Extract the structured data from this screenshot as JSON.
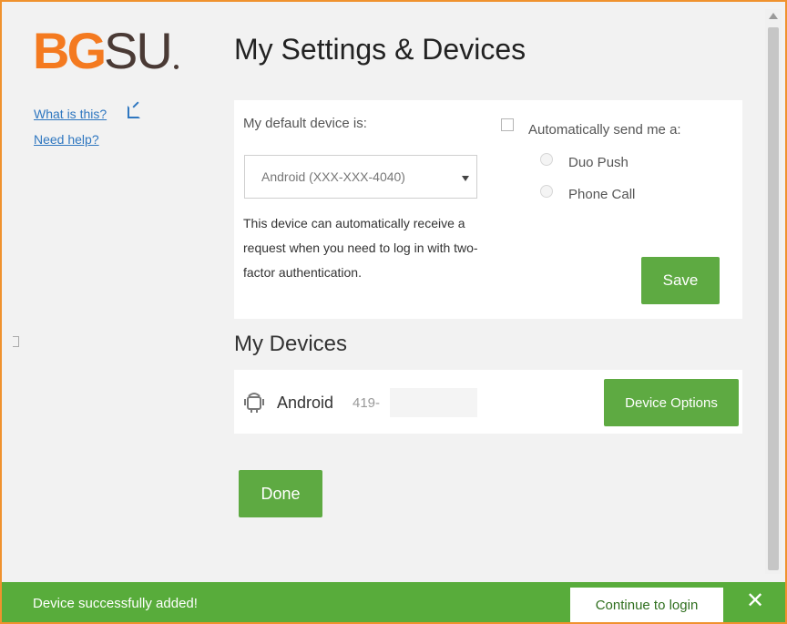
{
  "logo": {
    "part1": "BG",
    "part2": "SU"
  },
  "sidebar": {
    "what_is_this": "What is this?",
    "need_help": "Need help?"
  },
  "header": {
    "title": "My Settings & Devices"
  },
  "settings": {
    "default_device_label": "My default device is:",
    "default_device_value": "Android (XXX-XXX-4040)",
    "description": "This device can automatically receive a request when you need to log in with two-factor authentication.",
    "auto_send_label": "Automatically send me a:",
    "auto_send_checked": false,
    "options": [
      {
        "label": "Duo Push"
      },
      {
        "label": "Phone Call"
      }
    ],
    "save_label": "Save"
  },
  "devices": {
    "title": "My Devices",
    "items": [
      {
        "icon": "android-icon",
        "name": "Android",
        "number": "419-",
        "options_label": "Device Options"
      }
    ]
  },
  "done_label": "Done",
  "notification": {
    "message": "Device successfully added!",
    "continue_label": "Continue to login",
    "close": "✕"
  },
  "colors": {
    "brand_orange": "#f47a20",
    "accent_green": "#5eaa42",
    "border": "#f0922e"
  }
}
